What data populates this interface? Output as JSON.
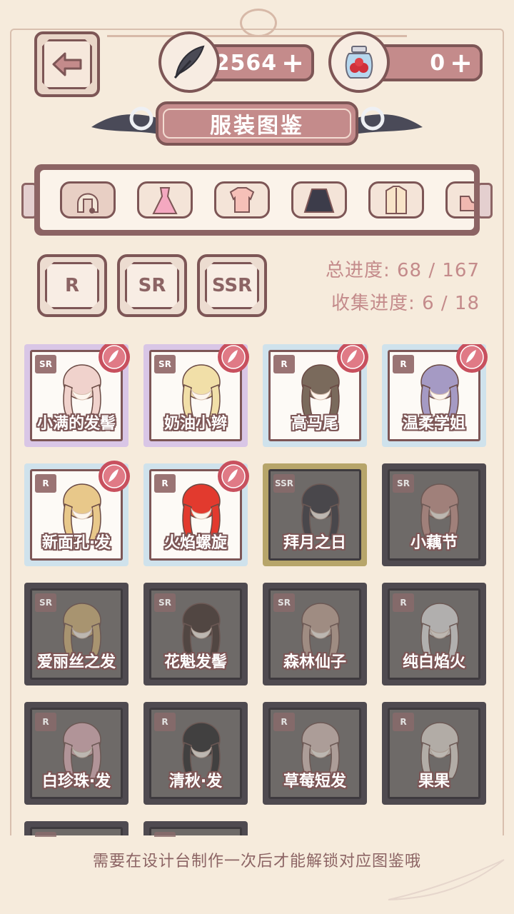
{
  "header": {
    "feather_count": "2564",
    "berry_count": "0",
    "plus": "+"
  },
  "title": "服装图鉴",
  "category_tabs": [
    {
      "icon": "hair-icon",
      "active": true
    },
    {
      "icon": "dress-icon",
      "active": false
    },
    {
      "icon": "top-icon",
      "active": false
    },
    {
      "icon": "skirt-icon",
      "active": false
    },
    {
      "icon": "coat-icon",
      "active": false
    },
    {
      "icon": "shoes-icon",
      "active": false
    }
  ],
  "rarity_filters": [
    "R",
    "SR",
    "SSR"
  ],
  "progress": {
    "total": "总进度: 68 / 167",
    "collection": "收集进度: 6 / 18"
  },
  "items": [
    {
      "name": "小满的发髻",
      "rarity": "SR",
      "state": "sr",
      "new": true,
      "color": "#f0d2cc"
    },
    {
      "name": "奶油小辫",
      "rarity": "SR",
      "state": "sr",
      "new": true,
      "color": "#f1dfa8"
    },
    {
      "name": "高马尾",
      "rarity": "R",
      "state": "r",
      "new": true,
      "color": "#7a6a5c"
    },
    {
      "name": "温柔学姐",
      "rarity": "R",
      "state": "r",
      "new": true,
      "color": "#a59ac4"
    },
    {
      "name": "新面孔·发",
      "rarity": "R",
      "state": "r",
      "new": true,
      "color": "#e8c88a"
    },
    {
      "name": "火焰螺旋",
      "rarity": "R",
      "state": "r",
      "new": true,
      "color": "#e23a2e"
    },
    {
      "name": "拜月之日",
      "rarity": "SSR",
      "state": "locked-gold",
      "new": false,
      "color": "#2c2c34"
    },
    {
      "name": "小藕节",
      "rarity": "SR",
      "state": "locked",
      "new": false,
      "color": "#c9938a"
    },
    {
      "name": "爱丽丝之发",
      "rarity": "SR",
      "state": "locked",
      "new": false,
      "color": "#d8b878"
    },
    {
      "name": "花魁发髻",
      "rarity": "SR",
      "state": "locked",
      "new": false,
      "color": "#3a2a24"
    },
    {
      "name": "森林仙子",
      "rarity": "SR",
      "state": "locked",
      "new": false,
      "color": "#c8a898"
    },
    {
      "name": "纯白焰火",
      "rarity": "R",
      "state": "locked",
      "new": false,
      "color": "#e8e8e8"
    },
    {
      "name": "白珍珠·发",
      "rarity": "R",
      "state": "locked",
      "new": false,
      "color": "#e8b8c0"
    },
    {
      "name": "清秋·发",
      "rarity": "R",
      "state": "locked",
      "new": false,
      "color": "#1e1e20"
    },
    {
      "name": "草莓短发",
      "rarity": "R",
      "state": "locked",
      "new": false,
      "color": "#e0c8c0"
    },
    {
      "name": "果果",
      "rarity": "R",
      "state": "locked",
      "new": false,
      "color": "#eae2da"
    },
    {
      "name": "",
      "rarity": "R",
      "state": "locked",
      "new": false,
      "color": "#999999"
    },
    {
      "name": "",
      "rarity": "R",
      "state": "locked",
      "new": false,
      "color": "#999999"
    }
  ],
  "footer": "需要在设计台制作一次后才能解锁对应图鉴哦",
  "colors": {
    "frame": "#7d5656",
    "accent": "#c48b8b",
    "background": "#f6ebdc"
  }
}
